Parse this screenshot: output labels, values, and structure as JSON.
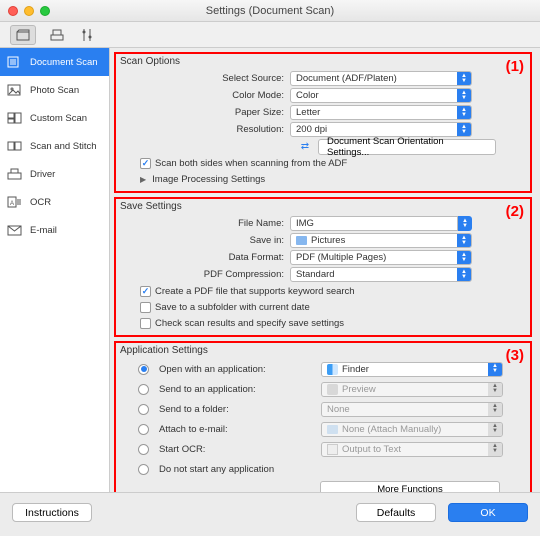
{
  "window": {
    "title": "Settings (Document Scan)"
  },
  "sidebar": {
    "items": [
      {
        "label": "Document Scan"
      },
      {
        "label": "Photo Scan"
      },
      {
        "label": "Custom Scan"
      },
      {
        "label": "Scan and Stitch"
      },
      {
        "label": "Driver"
      },
      {
        "label": "OCR"
      },
      {
        "label": "E-mail"
      }
    ]
  },
  "groups": {
    "scan_options": {
      "title": "Scan Options",
      "marker": "(1)",
      "select_source_label": "Select Source:",
      "select_source_value": "Document (ADF/Platen)",
      "color_mode_label": "Color Mode:",
      "color_mode_value": "Color",
      "paper_size_label": "Paper Size:",
      "paper_size_value": "Letter",
      "resolution_label": "Resolution:",
      "resolution_value": "200 dpi",
      "orientation_btn": "Document Scan Orientation Settings...",
      "both_sides": "Scan both sides when scanning from the ADF",
      "image_processing": "Image Processing Settings"
    },
    "save_settings": {
      "title": "Save Settings",
      "marker": "(2)",
      "file_name_label": "File Name:",
      "file_name_value": "IMG",
      "save_in_label": "Save in:",
      "save_in_value": "Pictures",
      "data_format_label": "Data Format:",
      "data_format_value": "PDF (Multiple Pages)",
      "pdf_compression_label": "PDF Compression:",
      "pdf_compression_value": "Standard",
      "keyword_search": "Create a PDF file that supports keyword search",
      "subfolder": "Save to a subfolder with current date",
      "check_results": "Check scan results and specify save settings"
    },
    "app_settings": {
      "title": "Application Settings",
      "marker": "(3)",
      "open_with": "Open with an application:",
      "open_with_value": "Finder",
      "send_app": "Send to an application:",
      "send_app_value": "Preview",
      "send_folder": "Send to a folder:",
      "send_folder_value": "None",
      "attach_email": "Attach to e-mail:",
      "attach_email_value": "None (Attach Manually)",
      "start_ocr": "Start OCR:",
      "start_ocr_value": "Output to Text",
      "no_start": "Do not start any application",
      "more_functions": "More Functions"
    }
  },
  "footer": {
    "instructions": "Instructions",
    "defaults": "Defaults",
    "ok": "OK"
  }
}
